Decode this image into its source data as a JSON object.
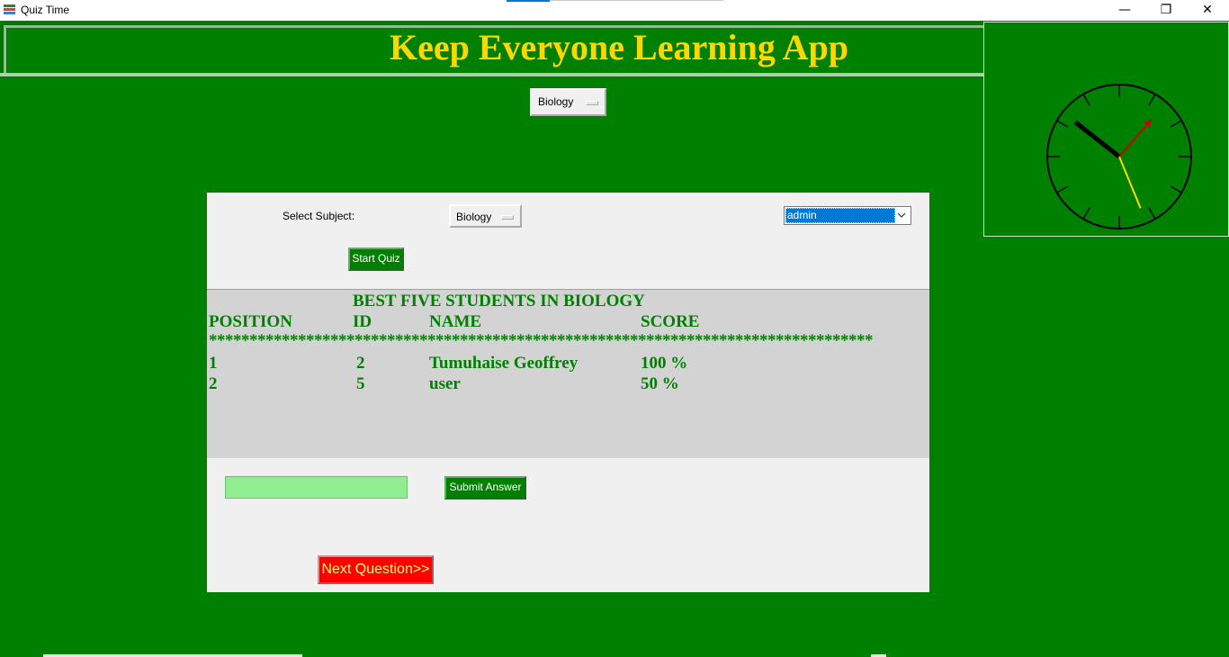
{
  "window": {
    "title": "Quiz Time",
    "minimize": "—",
    "restore": "❐",
    "close": "✕"
  },
  "banner": {
    "title": "Keep Everyone Learning App"
  },
  "top_subject_menu": {
    "value": "Biology"
  },
  "panel": {
    "select_subject_label": "Select Subject:",
    "subject_menu_value": "Biology",
    "user_combo_value": "admin",
    "start_button": "Start Quiz",
    "leaderboard": {
      "title": "BEST FIVE STUDENTS IN BIOLOGY",
      "headers": {
        "position": "POSITION",
        "id": "ID",
        "name": "NAME",
        "score": "SCORE"
      },
      "separator": "**********************************************************************************",
      "rows": [
        {
          "position": "1",
          "id": "2",
          "name": "Tumuhaise Geoffrey",
          "score": "100 %"
        },
        {
          "position": "2",
          "id": "5",
          "name": "user",
          "score": "50 %"
        }
      ]
    },
    "answer_value": "",
    "submit_button": "Submit Answer",
    "next_button": "Next Question>>"
  },
  "clock": {
    "hour": 11,
    "minute": 2,
    "second": 32
  },
  "colors": {
    "background": "#008000",
    "title": "#ffd700",
    "next_button": "#ff0000",
    "answer_field": "#90ee90"
  }
}
